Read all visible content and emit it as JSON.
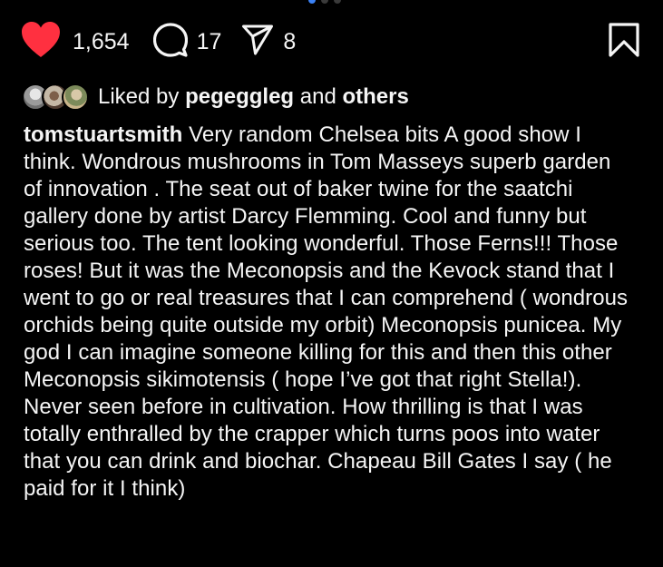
{
  "actions": {
    "likes": "1,654",
    "comments": "17",
    "shares": "8"
  },
  "icons": {
    "like": "heart-icon",
    "comment": "comment-bubble-icon",
    "share": "paper-plane-icon",
    "save": "bookmark-icon"
  },
  "colors": {
    "like": "#ff3040",
    "background": "#000000",
    "text": "#f5f5f5"
  },
  "liked_by": {
    "prefix": "Liked by ",
    "user": "pegeggleg",
    "middle": " and ",
    "others": "others"
  },
  "caption": {
    "username": "tomstuartsmith",
    "text": " Very random Chelsea bits  A good show I think.  Wondrous mushrooms in Tom Masseys superb garden of innovation . The seat out of baker twine for the saatchi gallery done by artist Darcy Flemming.  Cool and funny but serious too. The tent looking wonderful.  Those Ferns!!! Those roses!  But it was the Meconopsis and the Kevock stand that  I went to go or real treasures that I can comprehend ( wondrous orchids being quite outside my orbit) Meconopsis punicea.  My god I can imagine someone killing for this and then this other Meconopsis sikimotensis ( hope I’ve got that right Stella!). Never seen before in cultivation.  How thrilling is that  I was totally enthralled by the crapper which turns poos into water that you can drink and biochar.  Chapeau Bill Gates I say ( he paid for it I think)"
  }
}
